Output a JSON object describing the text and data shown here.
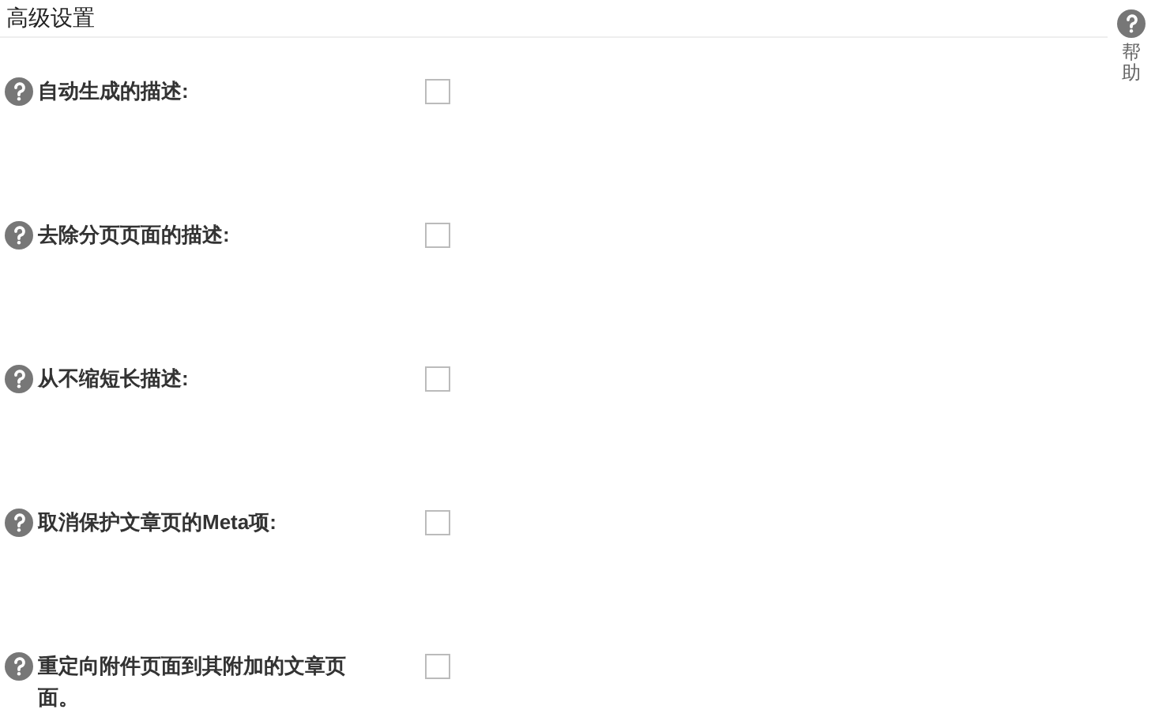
{
  "title": "高级设置",
  "help": {
    "label": "帮助"
  },
  "options": [
    {
      "label": "自动生成的描述:",
      "checked": false
    },
    {
      "label": "去除分页页面的描述:",
      "checked": false
    },
    {
      "label": "从不缩短长描述:",
      "checked": false
    },
    {
      "label": "取消保护文章页的Meta项:",
      "checked": false
    },
    {
      "label": "重定向附件页面到其附加的文章页面。",
      "checked": false
    }
  ]
}
